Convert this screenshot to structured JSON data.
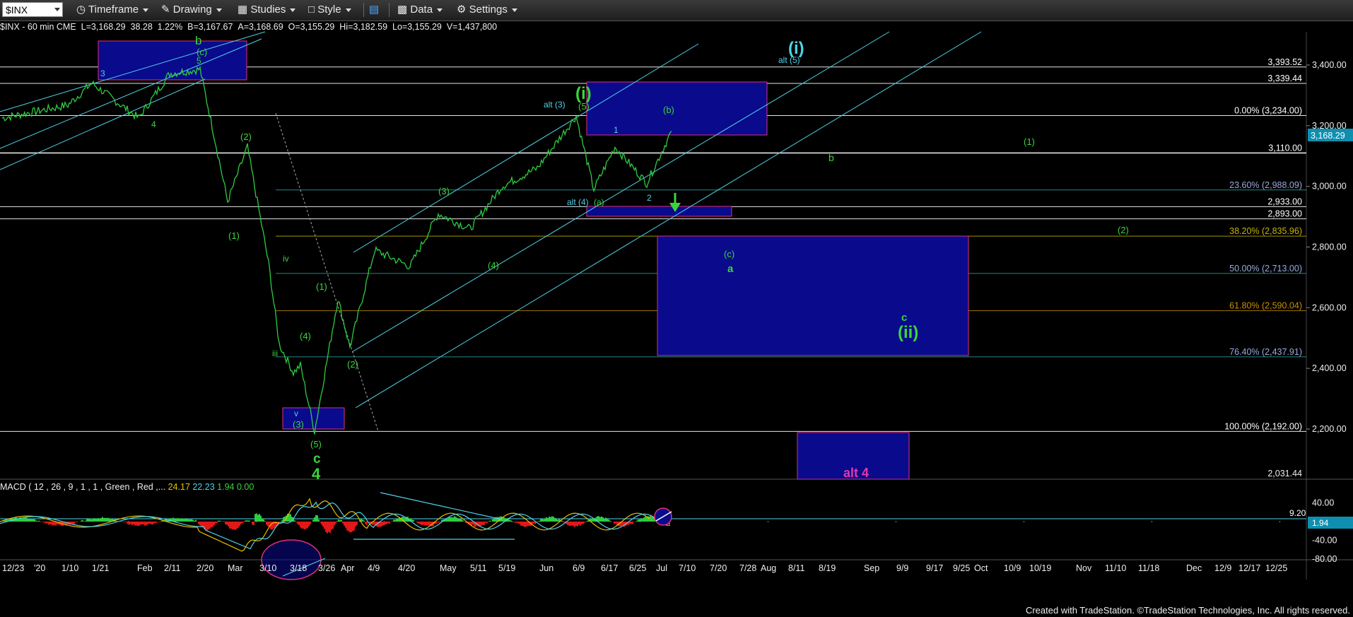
{
  "toolbar": {
    "symbol": "$INX",
    "items": [
      {
        "name": "timeframe",
        "label": "Timeframe",
        "icon": "clock-icon"
      },
      {
        "name": "drawing",
        "label": "Drawing",
        "icon": "pencil-icon"
      },
      {
        "name": "studies",
        "label": "Studies",
        "icon": "studies-icon"
      },
      {
        "name": "style",
        "label": "Style",
        "icon": "style-icon"
      },
      {
        "name": "layout",
        "label": "",
        "icon": "layout-icon"
      },
      {
        "name": "data",
        "label": "Data",
        "icon": "data-icon"
      },
      {
        "name": "settings",
        "label": "Settings",
        "icon": "gear-icon"
      }
    ]
  },
  "info": {
    "symbol": "$INX - 60 min",
    "exchange": "CME",
    "last": "L=3,168.29",
    "change": "38.28",
    "pct": "1.22%",
    "bid": "B=3,167.67",
    "ask": "A=3,168.69",
    "open": "O=3,155.29",
    "high": "Hi=3,182.59",
    "low": "Lo=3,155.29",
    "volume": "V=1,437,800"
  },
  "macd_label": {
    "name": "MACD ( 12 , 26 , 9 , 1 , 1 , Green , Red ,...",
    "v1": "24.17",
    "v2": "22.23",
    "v3": "1.94",
    "v4": "0.00"
  },
  "credit": "Created with TradeStation. ©TradeStation Technologies, Inc. All rights reserved.",
  "colors": {
    "price": "#2ecc40",
    "cyan": "#4fd2e8",
    "wave_green": "#3cd43c",
    "box_fill": "#0a0a8c",
    "box_border": "#e0307a",
    "last_price_bg": "#0e8fb0"
  },
  "chart_data": {
    "type": "line",
    "title": "",
    "y_axis": {
      "min": 2031.44,
      "max": 3460,
      "ticks": [
        "2,200.00",
        "2,400.00",
        "2,600.00",
        "2,800.00",
        "3,000.00",
        "3,200.00",
        "3,400.00"
      ],
      "tick_values": [
        2200,
        2400,
        2600,
        2800,
        3000,
        3200,
        3400
      ],
      "bottom_label": "2,031.44"
    },
    "x_axis": {
      "labels": [
        "12/23",
        "'20",
        "1/10",
        "1/21",
        "Feb",
        "2/11",
        "2/20",
        "Mar",
        "3/10",
        "3/18",
        "3/26",
        "Apr",
        "4/9",
        "4/20",
        "May",
        "5/11",
        "5/19",
        "Jun",
        "6/9",
        "6/17",
        "6/25",
        "Jul",
        "7/10",
        "7/20",
        "7/28",
        "Aug",
        "8/11",
        "8/19",
        "Sep",
        "9/9",
        "9/17",
        "9/25",
        "Oct",
        "10/9",
        "10/19",
        "Nov",
        "11/10",
        "11/18",
        "Dec",
        "12/9",
        "12/17",
        "12/25"
      ]
    },
    "last_price": "3,168.29",
    "series": [
      {
        "name": "",
        "dates": [
          "12/23",
          "1/10",
          "1/21",
          "2/1",
          "2/11",
          "2/20",
          "2/24",
          "2/28",
          "3/3",
          "3/9",
          "3/12",
          "3/16",
          "3/18",
          "3/23",
          "3/26",
          "4/1",
          "4/9",
          "4/20",
          "5/1",
          "5/11",
          "5/19",
          "6/1",
          "6/8",
          "6/11",
          "6/17",
          "6/26",
          "7/6"
        ],
        "values": [
          3225,
          3268,
          3340,
          3225,
          3372,
          3386,
          3200,
          2950,
          3130,
          2746,
          2480,
          2386,
          2410,
          2192,
          2630,
          2470,
          2790,
          2736,
          2910,
          2860,
          3000,
          3060,
          3232,
          2990,
          3130,
          3010,
          3182
        ]
      }
    ],
    "horizontal_levels": [
      {
        "value": 3393.52,
        "label": "3,393.52"
      },
      {
        "value": 3339.44,
        "label": "3,339.44"
      },
      {
        "value": 3233.5,
        "label": "0.00% (3,234.00)"
      },
      {
        "value": 3110.0,
        "label": "3,110.00"
      },
      {
        "value": 2988.09,
        "label": "23.60% (2,988.09)"
      },
      {
        "value": 2933.0,
        "label": "2,933.00"
      },
      {
        "value": 2893.0,
        "label": "2,893.00"
      },
      {
        "value": 2835.96,
        "label": "38.20% (2,835.96)"
      },
      {
        "value": 2713.0,
        "label": "50.00% (2,713.00)"
      },
      {
        "value": 2590.04,
        "label": "61.80% (2,590.04)"
      },
      {
        "value": 2437.91,
        "label": "76.40% (2,437.91)"
      },
      {
        "value": 2192.0,
        "label": "100.00% (2,192.00)"
      }
    ],
    "wave_labels": [
      "b",
      "(c)",
      "3",
      "5",
      "4",
      "(2)",
      "(1)",
      "iv",
      "iii",
      "(4)",
      "(1)",
      "(2)",
      "v",
      "(3)",
      "(5)",
      "c",
      "4",
      "(3)",
      "(4)",
      "alt (3)",
      "(5)",
      "(i)",
      "alt (4)",
      "(a)",
      "1",
      "2",
      "(b)",
      "(i)",
      "alt (5)",
      "(1)",
      "b",
      "(2)",
      "(c)",
      "a",
      "c",
      "(ii)",
      "alt 4"
    ],
    "macd": {
      "y_ticks": [
        "40.00",
        "-40.00",
        "-80.00"
      ],
      "tick_values": [
        40,
        -40,
        -80
      ],
      "level_label": "9.20",
      "current": "1.94"
    }
  }
}
